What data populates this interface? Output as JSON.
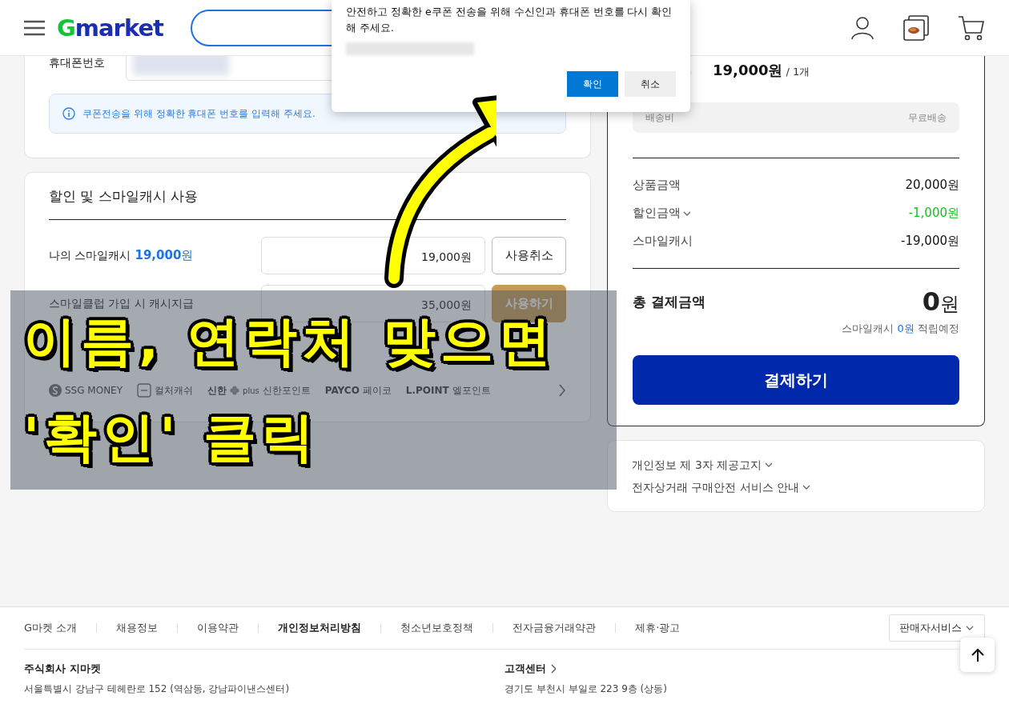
{
  "header": {
    "logo": "Gmarket"
  },
  "dialog": {
    "message": "안전하고 정확한 e쿠폰 전송을 위해 수신인과 휴대폰 번호를 다시 확인해 주세요.",
    "confirm": "확인",
    "cancel": "취소"
  },
  "phone_card": {
    "label": "휴대폰번호",
    "notice": "쿠폰전송을 위해 정확한 휴대폰 번호를 입력해 주세요."
  },
  "discount_card": {
    "title": "할인 및 스마일캐시 사용",
    "rows": [
      {
        "label": "나의 스마일캐시",
        "amount": "19,000",
        "unit": "원",
        "value": "19,000원",
        "button": "사용취소",
        "primary": false
      },
      {
        "label": "스마일클럽 가입 시 캐시지급",
        "value": "35,000원",
        "button": "사용하기",
        "primary": true
      }
    ],
    "points": [
      {
        "kind": "ssg",
        "name": "SSG MONEY"
      },
      {
        "kind": "culture",
        "name": "컬처캐쉬"
      },
      {
        "kind": "shinhan",
        "brand": "신한",
        "brand_sub": "plus",
        "name": "신한포인트"
      },
      {
        "kind": "payco",
        "brand": "PAYCO",
        "name": "페이코"
      },
      {
        "kind": "lpoint",
        "brand": "L.POINT",
        "name": "엘포인트"
      }
    ]
  },
  "summary": {
    "price": "19,000원",
    "qty": "/ 1개",
    "shipping": {
      "label": "배송비",
      "value": "무료배송"
    },
    "lines": [
      {
        "label": "상품금액",
        "value": "20,000원",
        "discount": false,
        "dropdown": false
      },
      {
        "label": "할인금액",
        "value": "-1,000원",
        "discount": true,
        "dropdown": true
      },
      {
        "label": "스마일캐시",
        "value": "-19,000원",
        "discount": false,
        "dropdown": false
      }
    ],
    "total": {
      "label": "총 결제금액",
      "amount": "0",
      "unit": "원"
    },
    "reward": {
      "prefix": "스마일캐시",
      "amount": "0원",
      "suffix": "적립예정"
    },
    "pay_button": "결제하기"
  },
  "info_links": [
    {
      "label": "개인정보 제 3자 제공고지"
    },
    {
      "label": "전자상거래 구매안전 서비스 안내"
    }
  ],
  "footer": {
    "links": [
      {
        "label": "G마켓 소개",
        "bold": false
      },
      {
        "label": "채용정보",
        "bold": false
      },
      {
        "label": "이용약관",
        "bold": false
      },
      {
        "label": "개인정보처리방침",
        "bold": true
      },
      {
        "label": "청소년보호정책",
        "bold": false
      },
      {
        "label": "전자금융거래약관",
        "bold": false
      },
      {
        "label": "제휴·광고",
        "bold": false
      }
    ],
    "seller_button": "판매자서비스",
    "company": {
      "name": "주식회사 지마켓",
      "address": "서울특별시 강남구 테헤란로 152 (역삼동, 강남파이낸스센터)"
    },
    "support": {
      "title": "고객센터",
      "address": "경기도 부천시 부일로 223 9층 (상동)"
    }
  },
  "annotation": {
    "lines": [
      "이름, 연락처 맞으면",
      "'확인' 클릭"
    ]
  }
}
